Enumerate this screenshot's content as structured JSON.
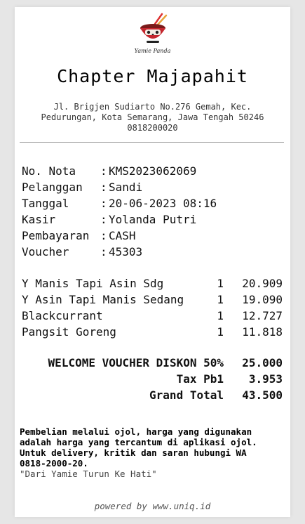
{
  "logo": {
    "brand": "Yamie Panda"
  },
  "store": {
    "name": "Chapter Majapahit",
    "address_lines": [
      "Jl. Brigjen Sudiarto No.276 Gemah, Kec.",
      "Pedurungan, Kota Semarang, Jawa Tengah 50246",
      "0818200020"
    ]
  },
  "info": [
    {
      "label": "No. Nota",
      "value": "KMS2023062069"
    },
    {
      "label": "Pelanggan",
      "value": "Sandi"
    },
    {
      "label": "Tanggal",
      "value": "20-06-2023 08:16"
    },
    {
      "label": "Kasir",
      "value": "Yolanda Putri"
    },
    {
      "label": "Pembayaran",
      "value": "CASH"
    },
    {
      "label": "Voucher",
      "value": "45303"
    }
  ],
  "items": [
    {
      "name": "Y Manis Tapi Asin Sdg",
      "qty": "1",
      "price": "20.909"
    },
    {
      "name": "Y Asin Tapi Manis Sedang",
      "qty": "1",
      "price": "19.090"
    },
    {
      "name": "Blackcurrant",
      "qty": "1",
      "price": "12.727"
    },
    {
      "name": "Pangsit Goreng",
      "qty": "1",
      "price": "11.818"
    }
  ],
  "totals": [
    {
      "label": "WELCOME VOUCHER DISKON 50%",
      "value": "25.000"
    },
    {
      "label": "Tax Pb1",
      "value": "3.953"
    },
    {
      "label": "Grand Total",
      "value": "43.500"
    }
  ],
  "footer": {
    "note_lines": [
      "Pembelian melalui ojol, harga yang digunakan",
      "adalah harga yang tercantum di aplikasi ojol.",
      "Untuk delivery, kritik dan saran hubungi WA",
      "0818-2000-20."
    ],
    "tagline": "\"Dari Yamie Turun Ke Hati\"",
    "powered_by": "powered by www.uniq.id"
  }
}
